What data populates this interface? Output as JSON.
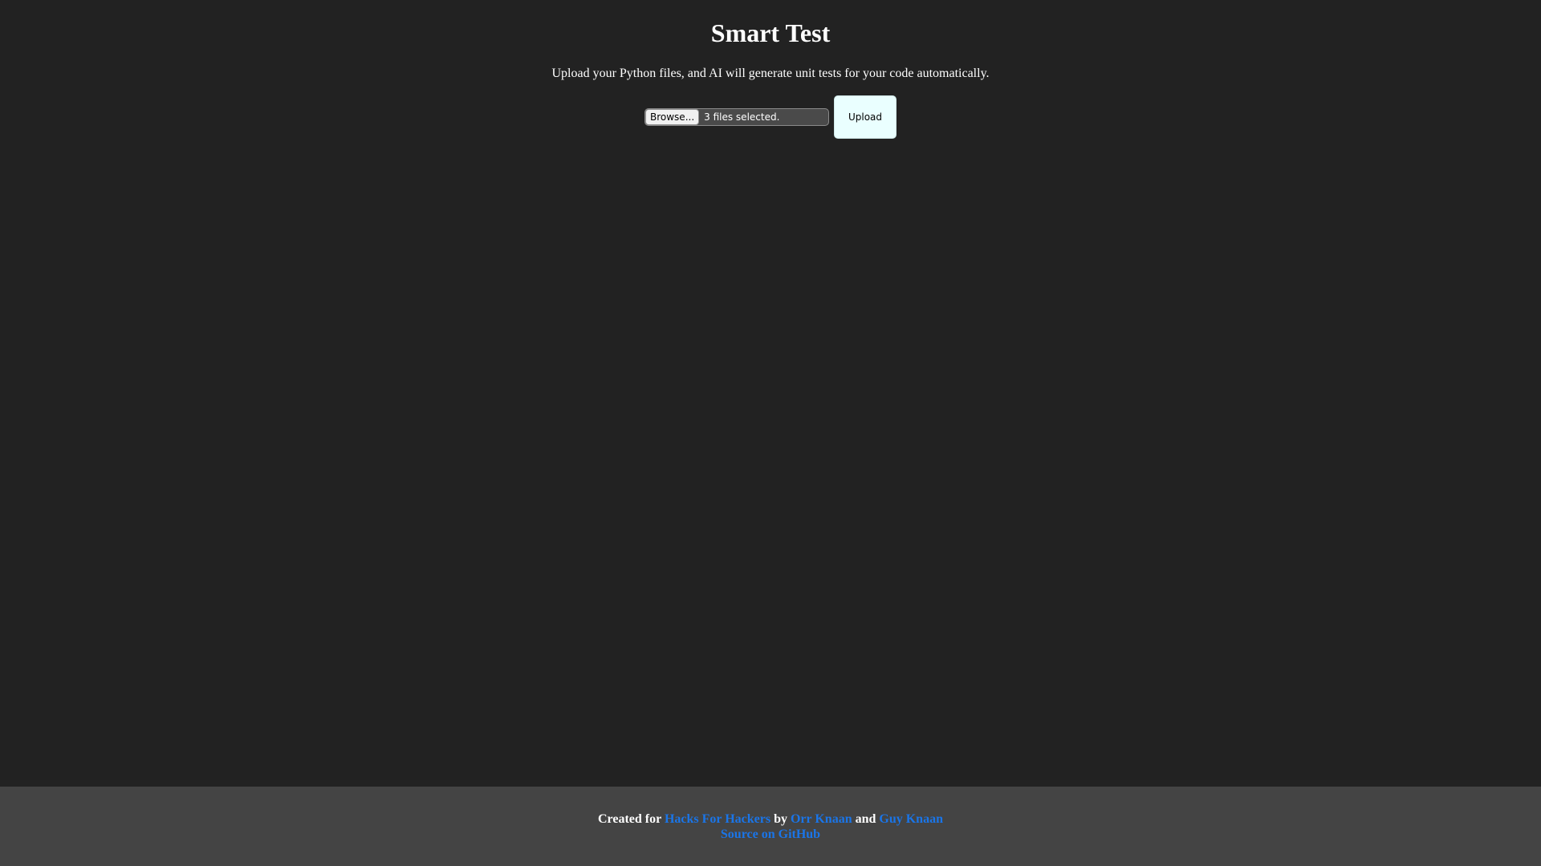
{
  "header": {
    "title": "Smart Test",
    "subtitle": "Upload your Python files, and AI will generate unit tests for your code automatically."
  },
  "upload": {
    "browse_label": "Browse...",
    "file_status": "3 files selected.",
    "upload_label": "Upload"
  },
  "footer": {
    "created_for": "Created for",
    "hackathon_link": "Hacks For Hackers",
    "by": "by",
    "author1_link": "Orr Knaan",
    "and": "and",
    "author2_link": "Guy Knaan",
    "source_link": "Source on GitHub"
  },
  "colors": {
    "background": "#222222",
    "footer_background": "#444444",
    "link": "#1a75e8",
    "upload_button": "#eaffff"
  }
}
